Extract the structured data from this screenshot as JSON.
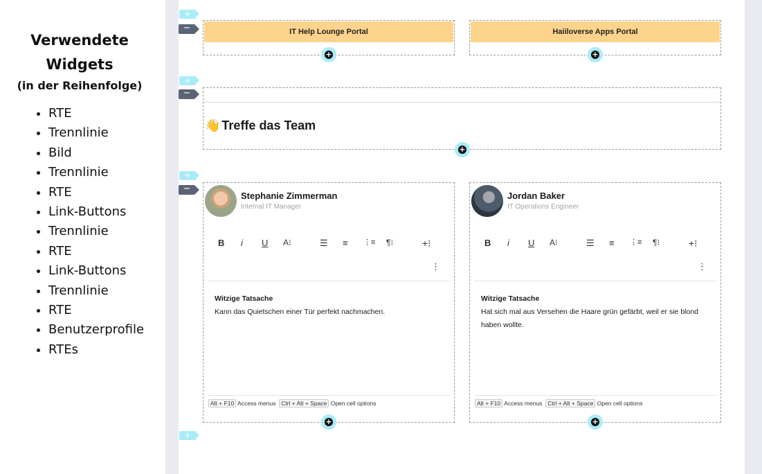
{
  "sidebar": {
    "title_line1": "Verwendete",
    "title_line2": "Widgets",
    "subtitle": "(in der Reihenfolge)",
    "items": [
      "RTE",
      "Trennlinie",
      "Bild",
      "Trennlinie",
      "RTE",
      "Link-Buttons",
      "Trennlinie",
      "RTE",
      "Link-Buttons",
      "Trennlinie",
      "RTE",
      "Benutzerprofile",
      "RTEs"
    ]
  },
  "portals": {
    "left_label": "IT Help Lounge Portal",
    "right_label": "Haiiloverse Apps Portal"
  },
  "team": {
    "emoji": "👋",
    "heading": "Treffe das Team"
  },
  "profiles": [
    {
      "name": "Stephanie Zimmerman",
      "role": "Internal IT Manager",
      "rte_title": "Witzige Tatsache",
      "rte_body": "Kann das Quietschen einer Tür perfekt nachmachen."
    },
    {
      "name": "Jordan Baker",
      "role": "IT Operations Engineer",
      "rte_title": "Witzige Tatsache",
      "rte_body": "Hat sich mal aus Versehen die Haare grün gefärbt, weil er sie blond haben wollte."
    }
  ],
  "toolbar": {
    "bold": "B",
    "italic": "i",
    "underline": "U",
    "font_size": "A⁝",
    "align_left": "☰",
    "align_center": "≡",
    "list": "⋮≡",
    "paragraph": "¶⁝",
    "insert": "+⁝",
    "more": "⋮"
  },
  "status": {
    "key1": "Alt + F10",
    "label1": "Access menus",
    "key2": "Ctrl + Alt + Space",
    "label2": "Open cell options"
  },
  "controls": {
    "add": "+",
    "collapse": "−"
  },
  "colors": {
    "accent": "#a9ecf7",
    "portal": "#fed48c",
    "gutter": "#e9ebf1"
  }
}
